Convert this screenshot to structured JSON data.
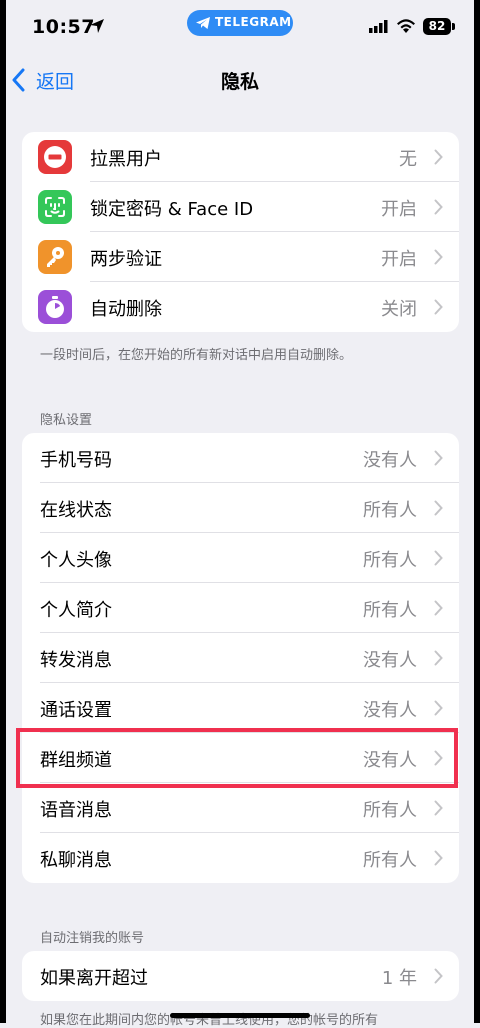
{
  "status_bar": {
    "time": "10:57",
    "app_pill": "TELEGRAM",
    "battery": "82"
  },
  "nav": {
    "back_label": "返回",
    "title": "隐私"
  },
  "security_group": [
    {
      "label": "拉黑用户",
      "value": "无",
      "icon": "block-icon",
      "color": "#e5393a"
    },
    {
      "label": "锁定密码 & Face ID",
      "value": "开启",
      "icon": "face-id-icon",
      "color": "#34c759"
    },
    {
      "label": "两步验证",
      "value": "开启",
      "icon": "key-icon",
      "color": "#f0932b"
    },
    {
      "label": "自动删除",
      "value": "关闭",
      "icon": "timer-icon",
      "color": "#9b4fd8"
    }
  ],
  "security_footnote": "一段时间后，在您开始的所有新对话中启用自动删除。",
  "privacy_header": "隐私设置",
  "privacy_group": [
    {
      "label": "手机号码",
      "value": "没有人"
    },
    {
      "label": "在线状态",
      "value": "所有人"
    },
    {
      "label": "个人头像",
      "value": "所有人"
    },
    {
      "label": "个人简介",
      "value": "所有人"
    },
    {
      "label": "转发消息",
      "value": "没有人"
    },
    {
      "label": "通话设置",
      "value": "没有人"
    },
    {
      "label": "群组频道",
      "value": "没有人"
    },
    {
      "label": "语音消息",
      "value": "所有人"
    },
    {
      "label": "私聊消息",
      "value": "所有人"
    }
  ],
  "account_header": "自动注销我的账号",
  "account_group": [
    {
      "label": "如果离开超过",
      "value": "1 年"
    }
  ],
  "account_footnote": "如果您在此期间内您的帐号未曾上线使用，您的帐号的所有",
  "colors": {
    "accent": "#1677f5",
    "highlight": "#f0304f",
    "telegram": "#2f8cf5"
  }
}
